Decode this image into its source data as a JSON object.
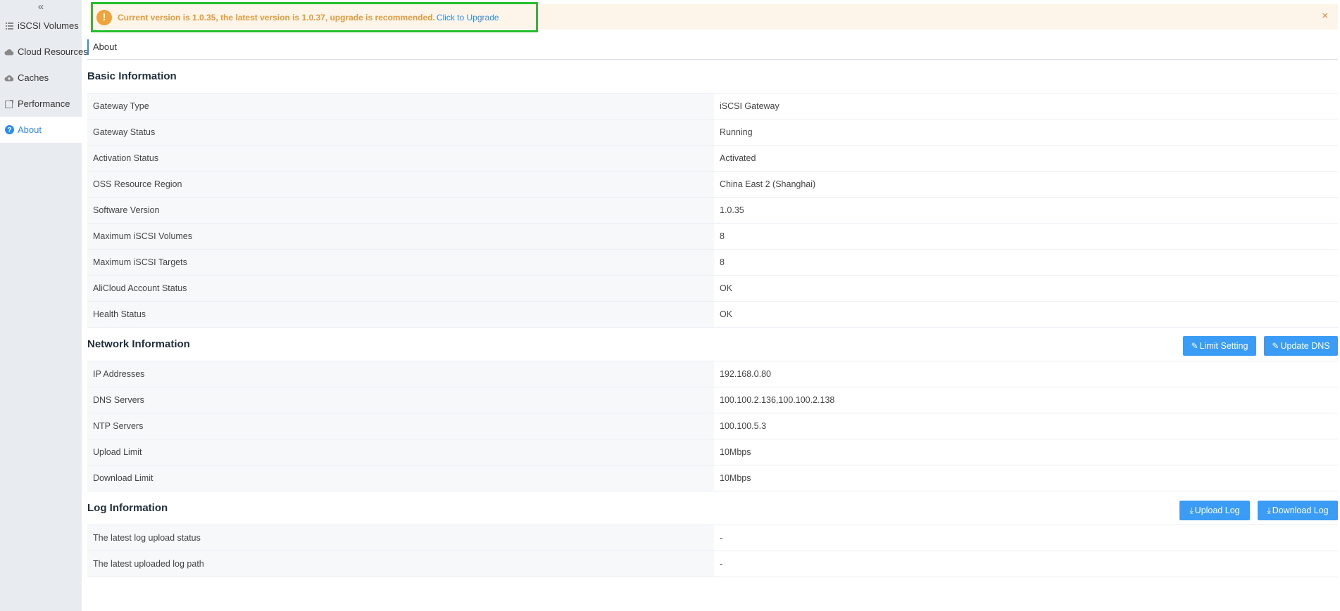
{
  "sidebar": {
    "collapse_glyph": "«",
    "items": [
      {
        "label": "iSCSI Volumes",
        "icon": "list-icon"
      },
      {
        "label": "Cloud Resources",
        "icon": "cloud-icon"
      },
      {
        "label": "Caches",
        "icon": "cloud-upload-icon"
      },
      {
        "label": "Performance",
        "icon": "chart-icon"
      },
      {
        "label": "About",
        "icon": "question-icon",
        "active": true
      }
    ]
  },
  "alert": {
    "text": "Current version is 1.0.35, the latest version is 1.0.37, upgrade is recommended.",
    "link": "Click to Upgrade",
    "close": "×"
  },
  "tab": {
    "label": "About"
  },
  "basic": {
    "title": "Basic Information",
    "rows": [
      {
        "k": "Gateway Type",
        "v": "iSCSI Gateway"
      },
      {
        "k": "Gateway Status",
        "v": "Running"
      },
      {
        "k": "Activation Status",
        "v": "Activated"
      },
      {
        "k": "OSS Resource Region",
        "v": "China East 2 (Shanghai)"
      },
      {
        "k": "Software Version",
        "v": "1.0.35"
      },
      {
        "k": "Maximum iSCSI Volumes",
        "v": "8"
      },
      {
        "k": "Maximum iSCSI Targets",
        "v": "8"
      },
      {
        "k": "AliCloud Account Status",
        "v": "OK"
      },
      {
        "k": "Health Status",
        "v": "OK"
      }
    ]
  },
  "network": {
    "title": "Network Information",
    "limit_btn": "Limit Setting",
    "dns_btn": "Update DNS",
    "rows": [
      {
        "k": "IP Addresses",
        "v": "192.168.0.80"
      },
      {
        "k": "DNS Servers",
        "v": "100.100.2.136,100.100.2.138"
      },
      {
        "k": "NTP Servers",
        "v": "100.100.5.3"
      },
      {
        "k": "Upload Limit",
        "v": "10Mbps"
      },
      {
        "k": "Download Limit",
        "v": "10Mbps"
      }
    ]
  },
  "log": {
    "title": "Log Information",
    "upload_btn": "Upload Log",
    "download_btn": "Download Log",
    "rows": [
      {
        "k": "The latest log upload status",
        "v": "-"
      },
      {
        "k": "The latest uploaded log path",
        "v": "-"
      }
    ]
  },
  "colors": {
    "accent": "#2d8cf0",
    "button": "#3a9cf5",
    "warning": "#f0a33b",
    "highlight": "#22c12c"
  }
}
